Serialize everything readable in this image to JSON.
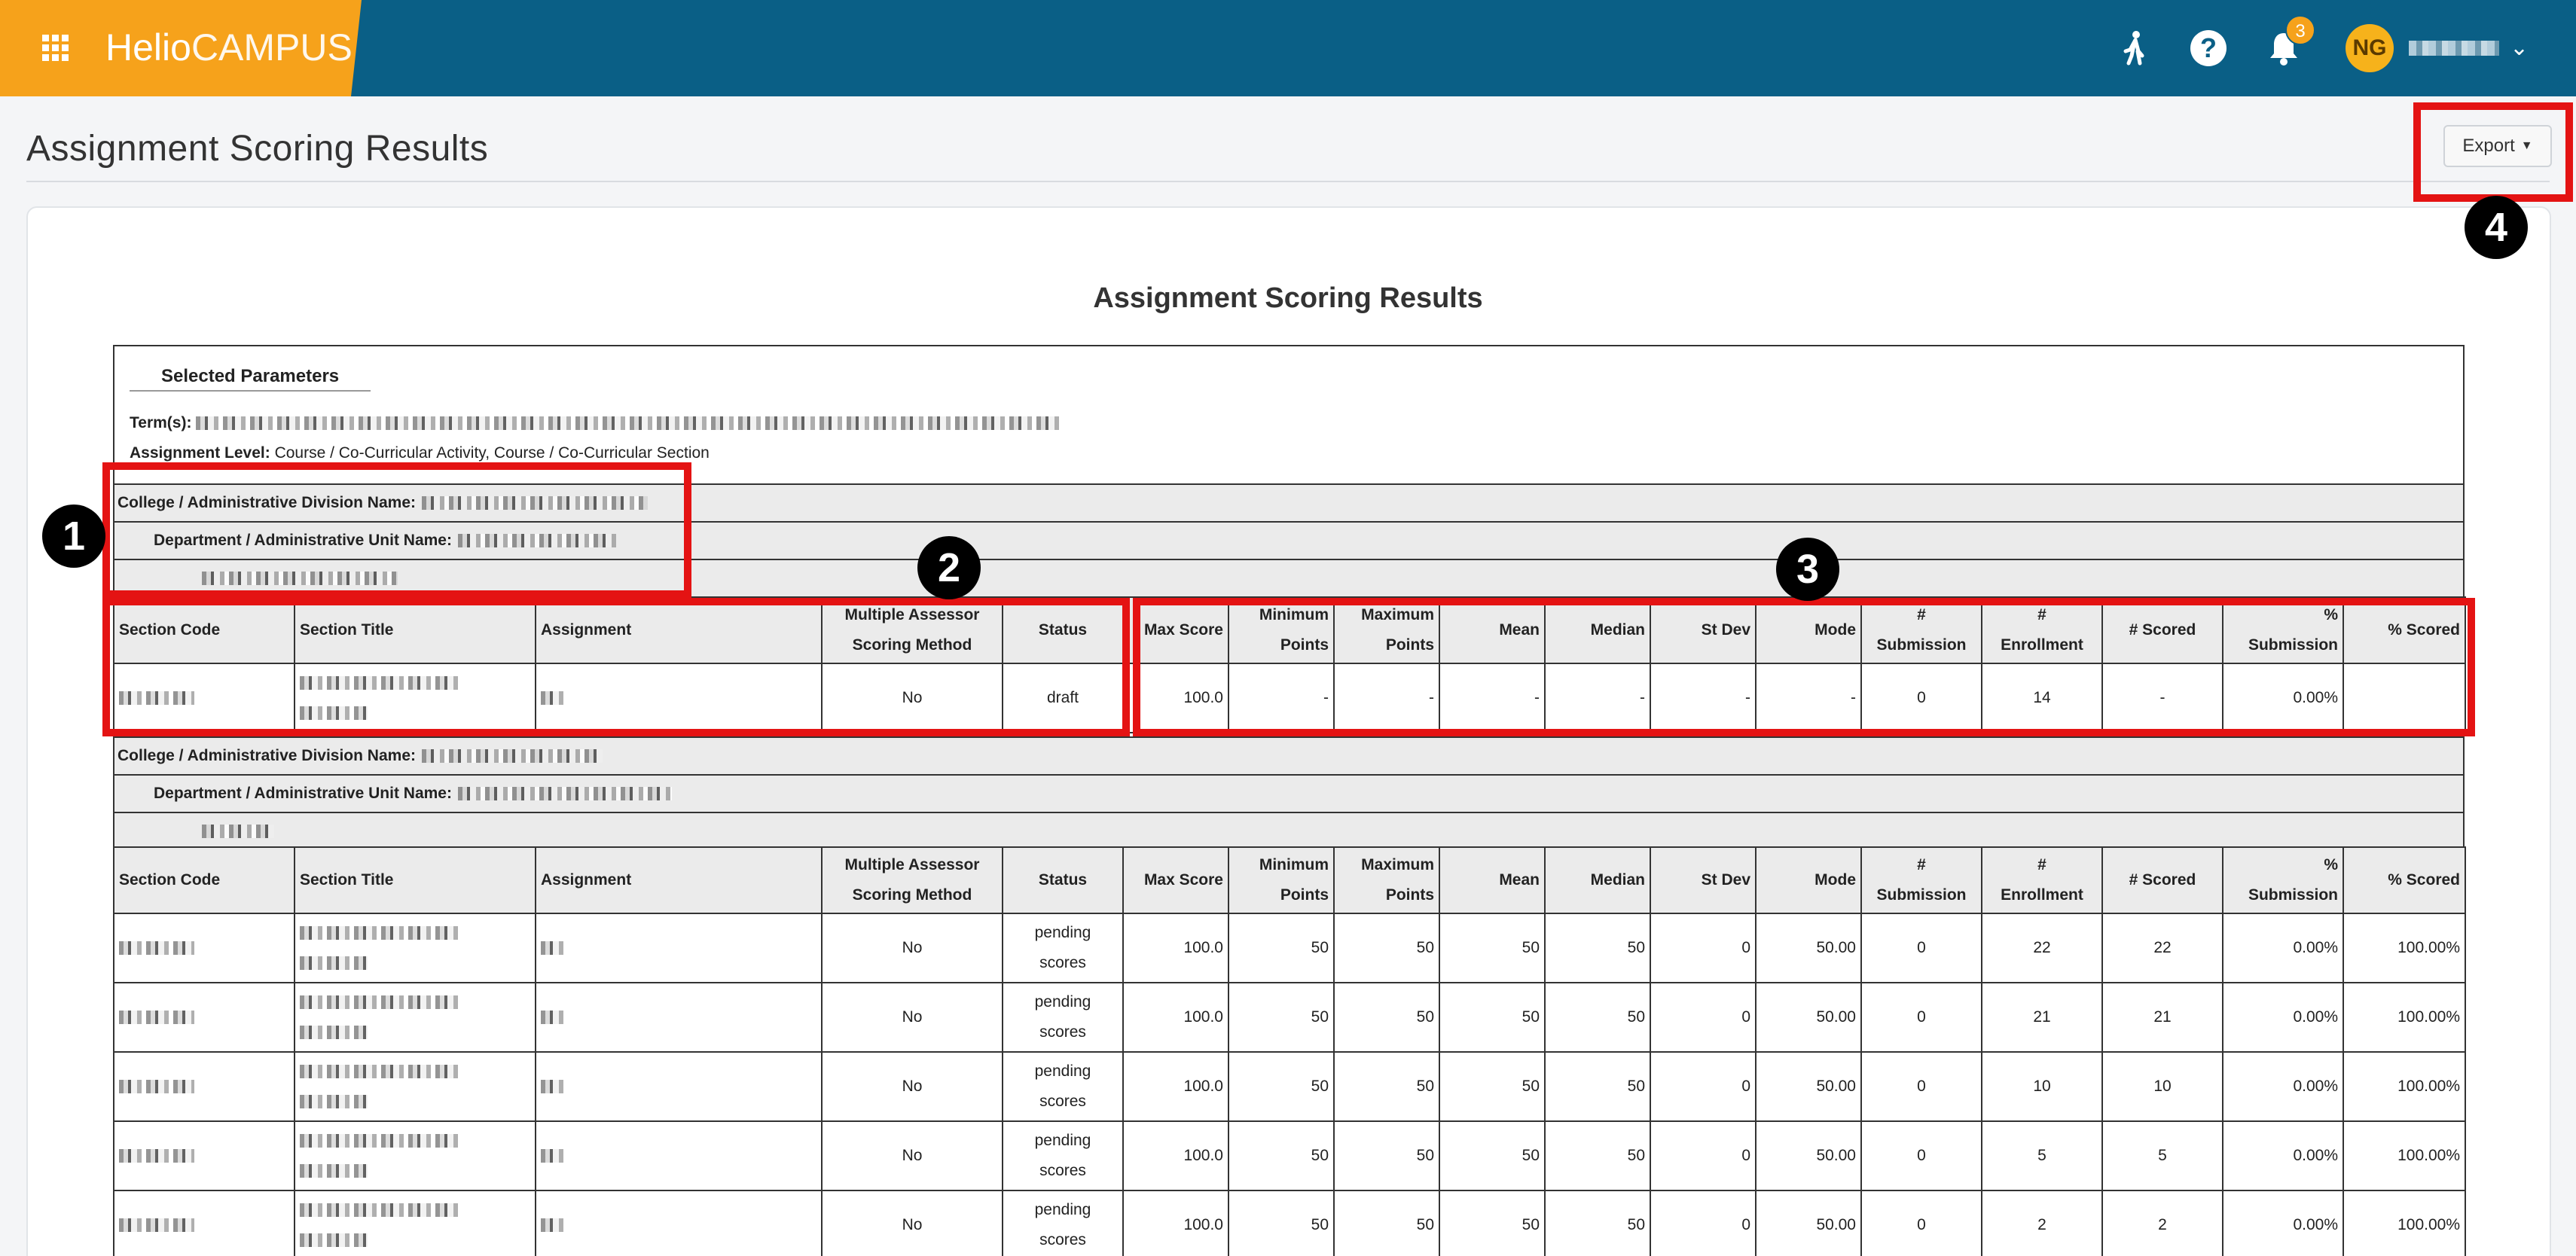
{
  "app": {
    "brand_main": "Helio",
    "brand_sub": "CAMPUS",
    "notifications_count": "3",
    "user_initials": "NG",
    "icons": [
      "apps-grid-icon",
      "walking-person-icon",
      "help-icon",
      "bell-icon",
      "chevron-down-icon"
    ]
  },
  "page": {
    "title": "Assignment Scoring Results",
    "export_label": "Export"
  },
  "report": {
    "title": "Assignment Scoring Results",
    "params_heading": "Selected Parameters",
    "terms_label": "Term(s):",
    "assignment_level_label": "Assignment Level:",
    "assignment_level_value": "Course / Co-Curricular Activity, Course / Co-Curricular Section"
  },
  "labels": {
    "college": "College / Administrative Division Name:",
    "department": "Department / Administrative Unit Name:"
  },
  "columns": [
    [
      "Section Code",
      ""
    ],
    [
      "Section Title",
      ""
    ],
    [
      "Assignment",
      ""
    ],
    [
      "Multiple Assessor",
      "Scoring Method"
    ],
    [
      "Status",
      ""
    ],
    [
      "Max Score",
      ""
    ],
    [
      "Minimum",
      "Points"
    ],
    [
      "Maximum",
      "Points"
    ],
    [
      "Mean",
      ""
    ],
    [
      "Median",
      ""
    ],
    [
      "St Dev",
      ""
    ],
    [
      "Mode",
      ""
    ],
    [
      "#",
      "Submission"
    ],
    [
      "#",
      "Enrollment"
    ],
    [
      "# Scored",
      ""
    ],
    [
      "%",
      "Submission"
    ],
    [
      "% Scored",
      ""
    ]
  ],
  "group1_rows": [
    {
      "multi": "No",
      "status": "draft",
      "status2": "",
      "max": "100.0",
      "min": "-",
      "maxp": "-",
      "mean": "-",
      "median": "-",
      "stdev": "-",
      "mode": "-",
      "sub": "0",
      "enr": "14",
      "scored": "-",
      "psub": "0.00%",
      "pscored": ""
    }
  ],
  "group2_rows": [
    {
      "multi": "No",
      "status": "pending",
      "status2": "scores",
      "max": "100.0",
      "min": "50",
      "maxp": "50",
      "mean": "50",
      "median": "50",
      "stdev": "0",
      "mode": "50.00",
      "sub": "0",
      "enr": "22",
      "scored": "22",
      "psub": "0.00%",
      "pscored": "100.00%"
    },
    {
      "multi": "No",
      "status": "pending",
      "status2": "scores",
      "max": "100.0",
      "min": "50",
      "maxp": "50",
      "mean": "50",
      "median": "50",
      "stdev": "0",
      "mode": "50.00",
      "sub": "0",
      "enr": "21",
      "scored": "21",
      "psub": "0.00%",
      "pscored": "100.00%"
    },
    {
      "multi": "No",
      "status": "pending",
      "status2": "scores",
      "max": "100.0",
      "min": "50",
      "maxp": "50",
      "mean": "50",
      "median": "50",
      "stdev": "0",
      "mode": "50.00",
      "sub": "0",
      "enr": "10",
      "scored": "10",
      "psub": "0.00%",
      "pscored": "100.00%"
    },
    {
      "multi": "No",
      "status": "pending",
      "status2": "scores",
      "max": "100.0",
      "min": "50",
      "maxp": "50",
      "mean": "50",
      "median": "50",
      "stdev": "0",
      "mode": "50.00",
      "sub": "0",
      "enr": "5",
      "scored": "5",
      "psub": "0.00%",
      "pscored": "100.00%"
    },
    {
      "multi": "No",
      "status": "pending",
      "status2": "scores",
      "max": "100.0",
      "min": "50",
      "maxp": "50",
      "mean": "50",
      "median": "50",
      "stdev": "0",
      "mode": "50.00",
      "sub": "0",
      "enr": "2",
      "scored": "2",
      "psub": "0.00%",
      "pscored": "100.00%"
    }
  ],
  "annotations": [
    "1",
    "2",
    "3",
    "4"
  ],
  "colors": {
    "header": "#0a5f86",
    "brand": "#f6a21b",
    "highlight": "#e41313"
  }
}
